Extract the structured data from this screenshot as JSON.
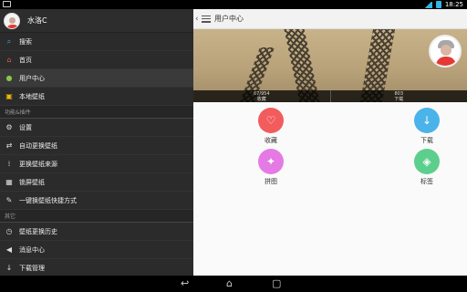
{
  "status_bar": {
    "time": "18:25"
  },
  "sidebar": {
    "user_name": "水洛C",
    "items_top": [
      {
        "label": "搜索",
        "icon": "search-icon",
        "color": "#33b5e5",
        "glyph": "⌕"
      },
      {
        "label": "首页",
        "icon": "home-icon",
        "color": "#e55a4e",
        "glyph": "⌂"
      },
      {
        "label": "用户中心",
        "icon": "user-icon",
        "color": "#8bc34a",
        "glyph": "👤"
      },
      {
        "label": "本地壁纸",
        "icon": "folder-icon",
        "color": "#f2b90c",
        "glyph": "▣"
      }
    ],
    "section_features": "功能&插件",
    "items_features": [
      {
        "label": "设置",
        "icon": "gear-icon",
        "glyph": "⚙"
      },
      {
        "label": "自动更换壁纸",
        "icon": "refresh-icon",
        "glyph": "⇄"
      },
      {
        "label": "更换壁纸来源",
        "icon": "grid-icon",
        "glyph": "⁞⁞"
      },
      {
        "label": "锁屏壁纸",
        "icon": "lock-icon",
        "glyph": "▦"
      },
      {
        "label": "一键换壁纸快捷方式",
        "icon": "wand-icon",
        "glyph": "✎"
      }
    ],
    "section_other": "其它",
    "items_other": [
      {
        "label": "壁纸更换历史",
        "icon": "clock-icon",
        "glyph": "◷"
      },
      {
        "label": "消息中心",
        "icon": "speaker-icon",
        "glyph": "◀"
      },
      {
        "label": "下载管理",
        "icon": "download-icon",
        "glyph": "↓"
      }
    ]
  },
  "main": {
    "title": "用户中心",
    "stats": [
      {
        "value": "67/954",
        "label": "收藏"
      },
      {
        "value": "803",
        "label": "下载"
      }
    ],
    "tiles": [
      {
        "label": "收藏",
        "icon": "heart-icon",
        "color": "#f25c5c",
        "glyph": "♡"
      },
      {
        "label": "下载",
        "icon": "download-icon",
        "color": "#4ab3ea",
        "glyph": "↓"
      },
      {
        "label": "拼图",
        "icon": "puzzle-icon",
        "color": "#e57ae5",
        "glyph": "✦"
      },
      {
        "label": "标签",
        "icon": "tag-icon",
        "color": "#5ccf8c",
        "glyph": "◈"
      }
    ]
  }
}
